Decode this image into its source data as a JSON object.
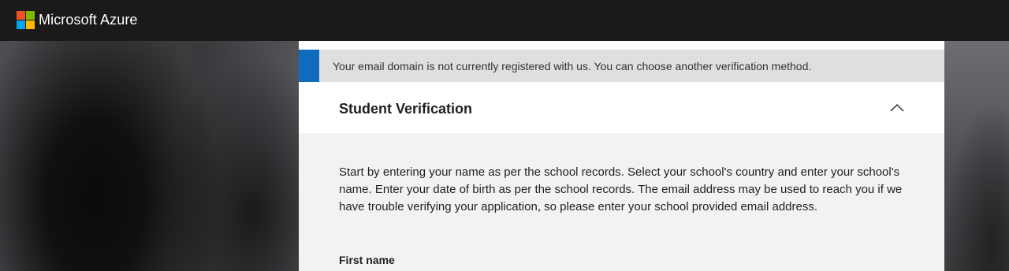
{
  "header": {
    "brand": "Microsoft Azure",
    "logo_icon": "microsoft-logo-icon",
    "logo_colors": [
      "#f25022",
      "#7fba00",
      "#00a4ef",
      "#ffb900"
    ]
  },
  "notice": {
    "text": "Your email domain is not currently registered with us. You can choose another verification method.",
    "accent_color": "#0f6cbd"
  },
  "section": {
    "title": "Student Verification",
    "toggle_icon": "chevron-up-icon",
    "description": "Start by entering your name as per the school records. Select your school's country and enter your school's name. Enter your date of birth as per the school records. The email address may be used to reach you if we have trouble verifying your application, so please enter your school provided email address."
  },
  "form": {
    "first_name_label": "First name"
  }
}
